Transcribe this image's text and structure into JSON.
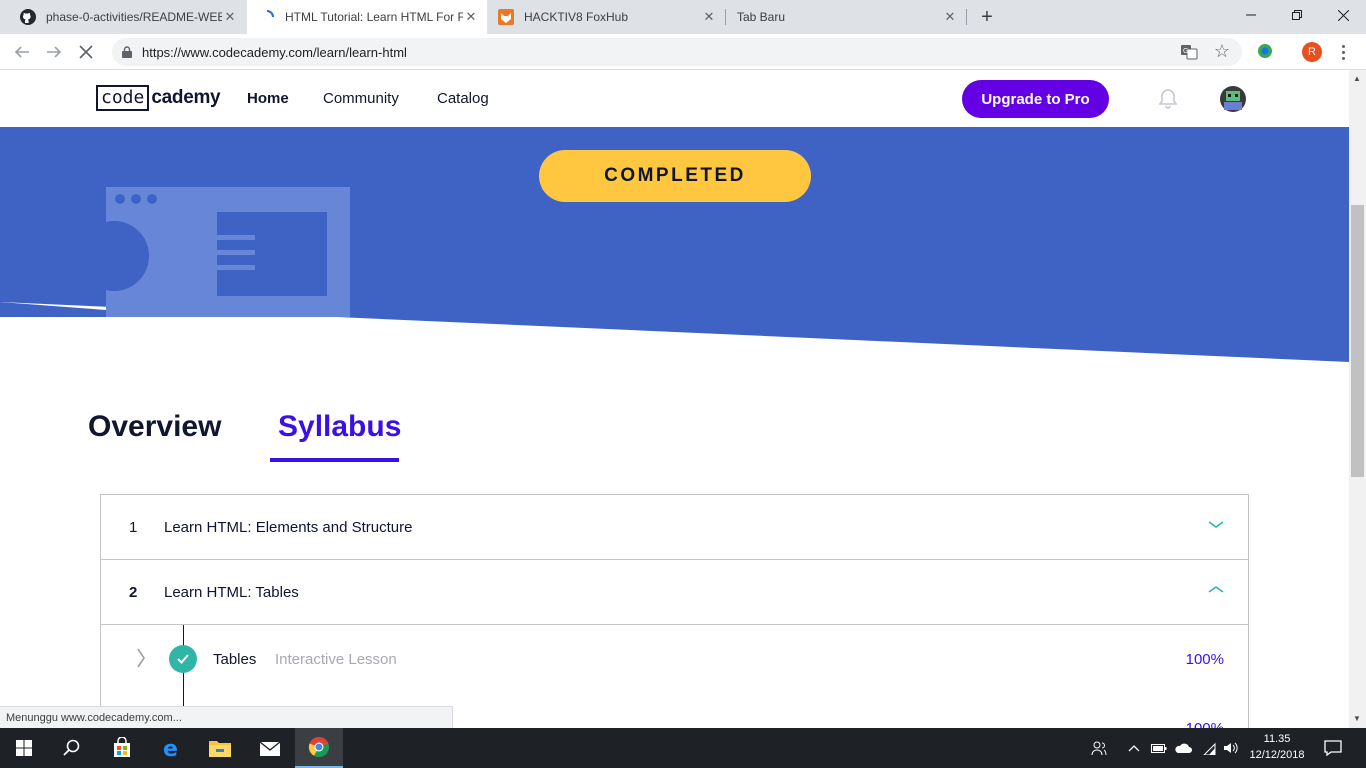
{
  "browser": {
    "tabs": [
      {
        "title": "phase-0-activities/README-WEE",
        "icon": "github-icon",
        "active": false
      },
      {
        "title": "HTML Tutorial: Learn HTML For F",
        "icon": "loading-spinner-icon",
        "active": true
      },
      {
        "title": "HACKTIV8 FoxHub",
        "icon": "fox-icon",
        "active": false
      },
      {
        "title": "Tab Baru",
        "icon": "",
        "active": false
      }
    ],
    "url": "https://www.codecademy.com/learn/learn-html",
    "profile_initial": "R",
    "status_text": "Menunggu www.codecademy.com..."
  },
  "site": {
    "logo_boxed": "code",
    "logo_rest": "cademy",
    "nav": [
      "Home",
      "Community",
      "Catalog"
    ],
    "upgrade_label": "Upgrade to Pro",
    "completed_label": "COMPLETED",
    "tabs": [
      "Overview",
      "Syllabus"
    ],
    "units": [
      {
        "number": "1",
        "title": "Learn HTML: Elements and Structure",
        "expanded": false
      },
      {
        "number": "2",
        "title": "Learn HTML: Tables",
        "expanded": true
      }
    ],
    "lessons": [
      {
        "title": "Tables",
        "type": "Interactive Lesson",
        "progress": "100%",
        "completed": true
      },
      {
        "title": "",
        "type": "...",
        "progress": "100%",
        "completed": true
      }
    ]
  },
  "taskbar": {
    "time": "11.35",
    "date": "12/12/2018"
  },
  "colors": {
    "hero_blue": "#3f63c5",
    "brand_purple": "#6400e4",
    "syllabus_purple": "#3a10e5",
    "completed_yellow": "#ffc740",
    "check_teal": "#2fb6a6"
  }
}
